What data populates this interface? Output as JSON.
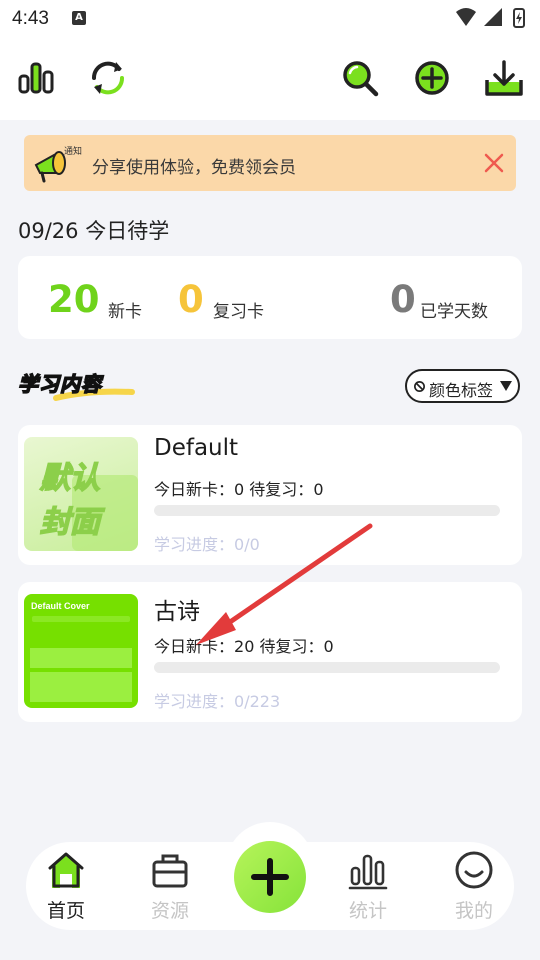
{
  "status": {
    "time": "4:43",
    "notif_letter": "A"
  },
  "toolbar": {
    "icons": [
      "bar-chart-icon",
      "sync-icon",
      "search-icon",
      "add-circle-icon",
      "download-icon"
    ],
    "accent": "#7be01e"
  },
  "banner": {
    "text": "分享使用体验，免费领会员",
    "badge": "通知"
  },
  "today": {
    "date": "09/26",
    "title": "今日待学"
  },
  "stats": {
    "new_count": "20",
    "new_label": "新卡",
    "review_count": "0",
    "review_label": "复习卡",
    "days_count": "0",
    "days_label": "已学天数"
  },
  "section": {
    "title": "学习内容",
    "filter_label": "颜色标签"
  },
  "decks": [
    {
      "title": "Default",
      "cover_text_line1": "默认",
      "cover_text_line2": "封面",
      "today_new_label": "今日新卡：",
      "today_new": "0",
      "review_label": "待复习：",
      "review": "0",
      "progress_label": "学习进度：",
      "progress": "0/0",
      "progress_fraction": 0
    },
    {
      "title": "古诗",
      "cover_title": "Default Cover",
      "today_new_label": "今日新卡：",
      "today_new": "20",
      "review_label": "待复习：",
      "review": "0",
      "progress_label": "学习进度：",
      "progress": "0/223",
      "progress_fraction": 0
    }
  ],
  "nav": {
    "home": "首页",
    "resources": "资源",
    "stats": "统计",
    "mine": "我的"
  },
  "colors": {
    "green": "#6fd31b",
    "yellow": "#f6c43a",
    "gray": "#7a7a7a",
    "banner_bg": "#fbd8a9",
    "close": "#ef5a4f",
    "arrow": "#e23b3b"
  }
}
